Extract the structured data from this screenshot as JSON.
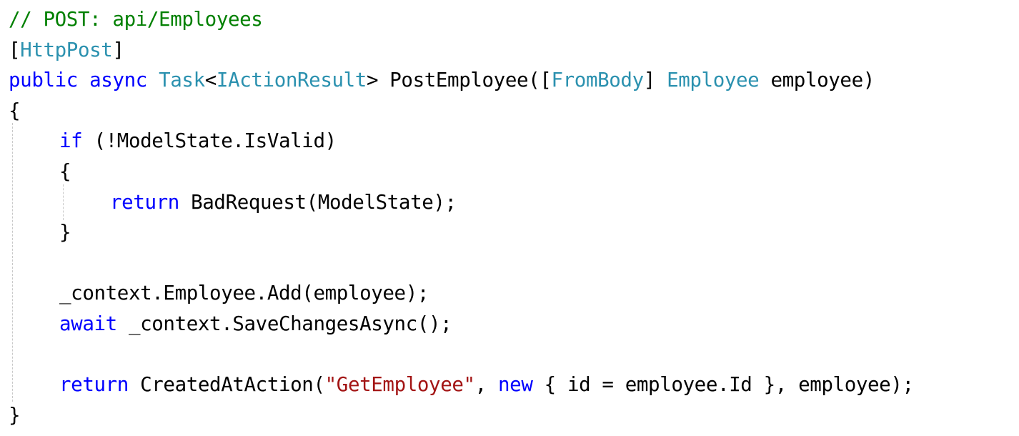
{
  "editor": {
    "colors": {
      "background": "#ffffff",
      "comment": "#008000",
      "keyword": "#0000ff",
      "type": "#2b91af",
      "string": "#a31515",
      "plain": "#000000"
    },
    "lines": [
      {
        "indent": 0,
        "tokens": [
          {
            "text": "// POST: api/Employees",
            "kind": "comment"
          }
        ]
      },
      {
        "indent": 0,
        "tokens": [
          {
            "text": "[",
            "kind": "plain"
          },
          {
            "text": "HttpPost",
            "kind": "type"
          },
          {
            "text": "]",
            "kind": "plain"
          }
        ]
      },
      {
        "indent": 0,
        "tokens": [
          {
            "text": "public",
            "kind": "keyword"
          },
          {
            "text": " ",
            "kind": "plain"
          },
          {
            "text": "async",
            "kind": "keyword"
          },
          {
            "text": " ",
            "kind": "plain"
          },
          {
            "text": "Task",
            "kind": "type"
          },
          {
            "text": "<",
            "kind": "plain"
          },
          {
            "text": "IActionResult",
            "kind": "type"
          },
          {
            "text": "> PostEmployee([",
            "kind": "plain"
          },
          {
            "text": "FromBody",
            "kind": "type"
          },
          {
            "text": "] ",
            "kind": "plain"
          },
          {
            "text": "Employee",
            "kind": "type"
          },
          {
            "text": " employee)",
            "kind": "plain"
          }
        ]
      },
      {
        "indent": 0,
        "tokens": [
          {
            "text": "{",
            "kind": "plain"
          }
        ]
      },
      {
        "indent": 1,
        "tokens": [
          {
            "text": "if",
            "kind": "keyword"
          },
          {
            "text": " (!ModelState.IsValid)",
            "kind": "plain"
          }
        ]
      },
      {
        "indent": 1,
        "tokens": [
          {
            "text": "{",
            "kind": "plain"
          }
        ]
      },
      {
        "indent": 2,
        "tokens": [
          {
            "text": "return",
            "kind": "keyword"
          },
          {
            "text": " BadRequest(ModelState);",
            "kind": "plain"
          }
        ]
      },
      {
        "indent": 1,
        "tokens": [
          {
            "text": "}",
            "kind": "plain"
          }
        ]
      },
      {
        "indent": 0,
        "tokens": []
      },
      {
        "indent": 1,
        "tokens": [
          {
            "text": "_context.Employee.Add(employee);",
            "kind": "plain"
          }
        ]
      },
      {
        "indent": 1,
        "tokens": [
          {
            "text": "await",
            "kind": "keyword"
          },
          {
            "text": " _context.SaveChangesAsync();",
            "kind": "plain"
          }
        ]
      },
      {
        "indent": 0,
        "tokens": []
      },
      {
        "indent": 1,
        "tokens": [
          {
            "text": "return",
            "kind": "keyword"
          },
          {
            "text": " CreatedAtAction(",
            "kind": "plain"
          },
          {
            "text": "\"GetEmployee\"",
            "kind": "string"
          },
          {
            "text": ", ",
            "kind": "plain"
          },
          {
            "text": "new",
            "kind": "keyword"
          },
          {
            "text": " { id = employee.Id }, employee);",
            "kind": "plain"
          }
        ]
      },
      {
        "indent": 0,
        "tokens": [
          {
            "text": "}",
            "kind": "plain"
          }
        ]
      }
    ]
  }
}
